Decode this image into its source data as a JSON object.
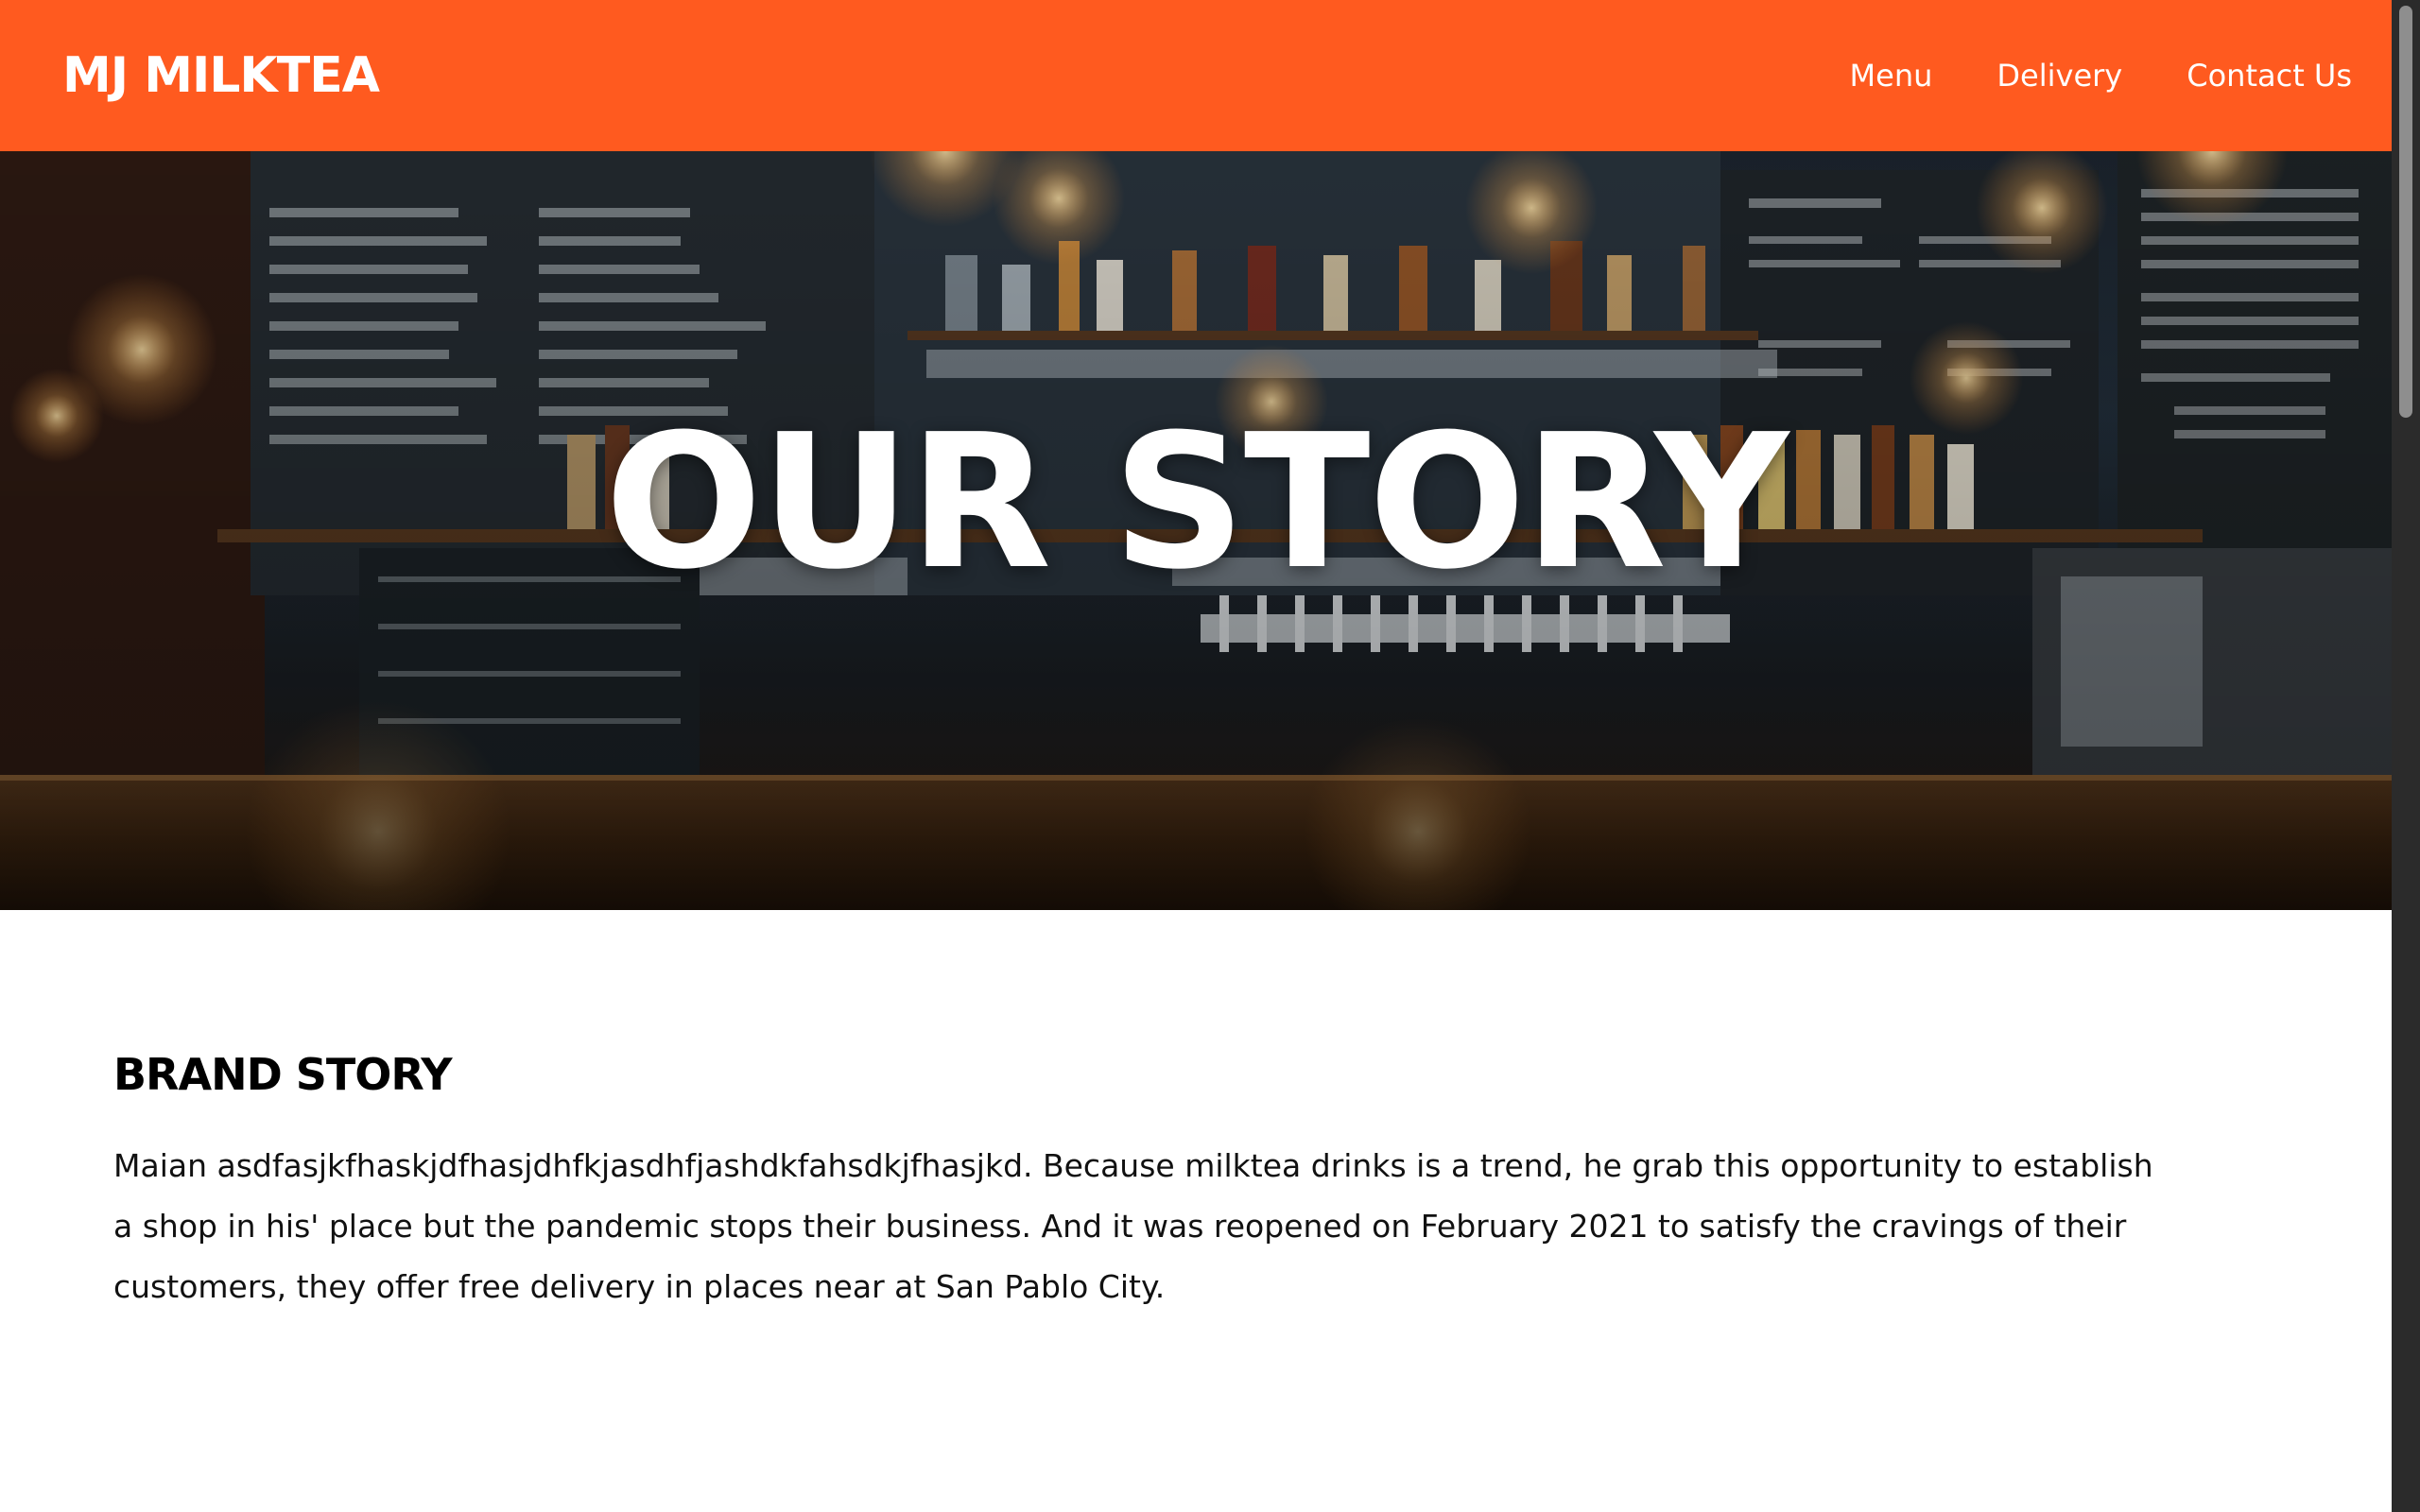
{
  "nav": {
    "brand": "MJ MILKTEA",
    "links": [
      "Menu",
      "Delivery",
      "Contact Us"
    ]
  },
  "hero": {
    "title": "OUR STORY"
  },
  "story": {
    "heading": "BRAND STORY",
    "paragraph": "Maian asdfasjkfhaskjdfhasjdhfkjasdhfjashdkfahsdkjfhasjkd. Because milktea drinks is a trend, he grab this opportunity to establish a shop in his' place but the pandemic stops their business. And it was reopened on February 2021 to satisfy the cravings of their customers, they offer free delivery in places near at San Pablo City."
  },
  "colors": {
    "accent": "#ff5a1f",
    "text": "#111111",
    "background": "#ffffff"
  }
}
